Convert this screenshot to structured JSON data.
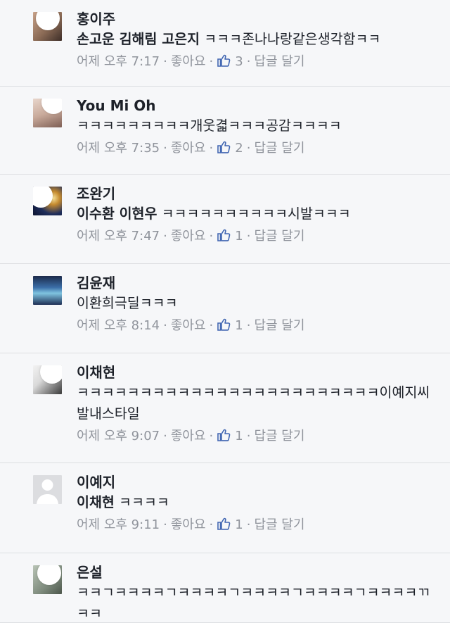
{
  "meta_labels": {
    "like": "좋아요",
    "reply": "답글 달기",
    "dot": "·"
  },
  "colors": {
    "like_blue": "#4267b2",
    "meta_gray": "#90949c",
    "divider": "#dddfe2"
  },
  "comments": [
    {
      "author": "홍이주",
      "mentions": "손고운 김해림 고은지",
      "text": "ㅋㅋㅋ존나나랑같은생각함ㅋㅋ",
      "time": "어제 오후 7:17",
      "likes": "3",
      "avatar_icon": "avatar-photo-icon"
    },
    {
      "author": "You Mi Oh",
      "mentions": "",
      "text": "ㅋㅋㅋㅋㅋㅋㅋㅋㅋ개웃겳ㅋㅋㅋ공감ㅋㅋㅋㅋ",
      "time": "어제 오후 7:35",
      "likes": "2",
      "avatar_icon": "avatar-photo-icon"
    },
    {
      "author": "조완기",
      "mentions": "이수환 이현우",
      "text": "ㅋㅋㅋㅋㅋㅋㅋㅋㅋㅋ시발ㅋㅋㅋ",
      "time": "어제 오후 7:47",
      "likes": "1",
      "avatar_icon": "avatar-photo-icon"
    },
    {
      "author": "김윤재",
      "mentions": "",
      "text": "이환희극딜ㅋㅋㅋ",
      "time": "어제 오후 8:14",
      "likes": "1",
      "avatar_icon": "avatar-photo-icon"
    },
    {
      "author": "이채현",
      "mentions": "",
      "text": "ㅋㅋㅋㅋㅋㅋㅋㅋㅋㅋㅋㅋㅋㅋㅋㅋㅋㅋㅋㅋㅋㅋㅋㅋ이예지씨발내스타일",
      "time": "어제 오후 9:07",
      "likes": "1",
      "avatar_icon": "avatar-photo-icon"
    },
    {
      "author": "이예지",
      "mentions": "이채현",
      "text": "ㅋㅋㅋㅋ",
      "time": "어제 오후 9:11",
      "likes": "1",
      "avatar_icon": "default-avatar-icon"
    },
    {
      "author": "은설",
      "mentions": "",
      "text": "ㅋㅋㄱㅋㅋㅋㅋㄱㅋㅋㅋㅋㄱㅋㅋㅋㅋㄱㅋㅋㅋㅋㄱㅋㅋㅋㅋㄲㅋㅋ",
      "time": "",
      "likes": "",
      "avatar_icon": "avatar-photo-icon"
    }
  ]
}
